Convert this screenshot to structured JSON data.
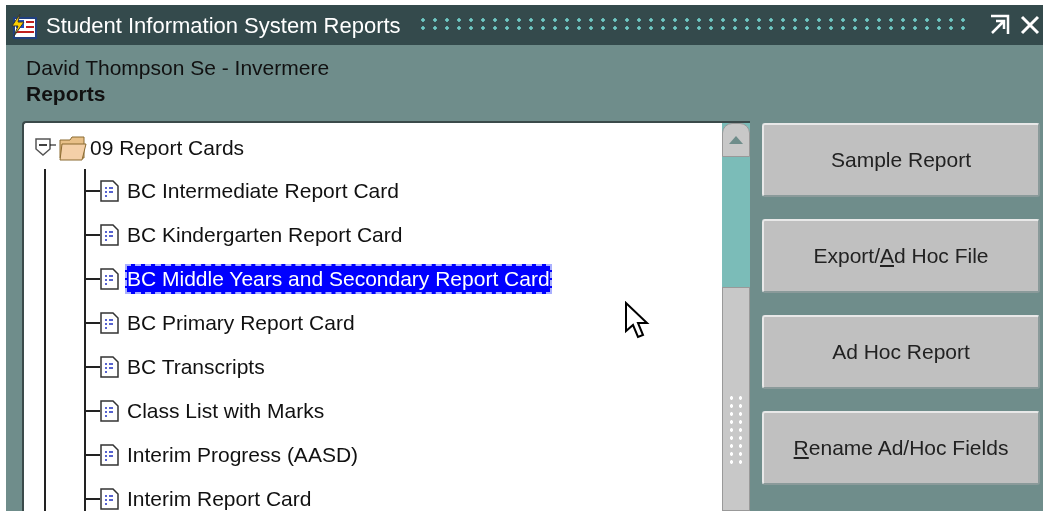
{
  "window": {
    "title": "Student Information System Reports"
  },
  "header": {
    "school": "David Thompson Se - Invermere",
    "section": "Reports"
  },
  "tree": {
    "label": "09 Report Cards",
    "expanded": true,
    "children": [
      {
        "label": "BC Intermediate Report Card",
        "selected": false
      },
      {
        "label": "BC Kindergarten Report Card",
        "selected": false
      },
      {
        "label": "BC Middle Years and Secondary Report Card",
        "selected": true
      },
      {
        "label": "BC Primary Report Card",
        "selected": false
      },
      {
        "label": "BC Transcripts",
        "selected": false
      },
      {
        "label": "Class List with Marks",
        "selected": false
      },
      {
        "label": "Interim Progress (AASD)",
        "selected": false
      },
      {
        "label": "Interim Report Card",
        "selected": false
      }
    ]
  },
  "buttons": [
    {
      "label": [
        {
          "text": "Sample Report",
          "underlined": false
        }
      ]
    },
    {
      "label": [
        {
          "text": "Export/",
          "underlined": false
        },
        {
          "text": "A",
          "underlined": true
        },
        {
          "text": "d Hoc File",
          "underlined": false
        }
      ]
    },
    {
      "label": [
        {
          "text": "Ad Hoc Report",
          "underlined": false
        }
      ]
    },
    {
      "label": [
        {
          "text": "R",
          "underlined": true
        },
        {
          "text": "ename Ad/Hoc Fields",
          "underlined": false
        }
      ]
    }
  ]
}
